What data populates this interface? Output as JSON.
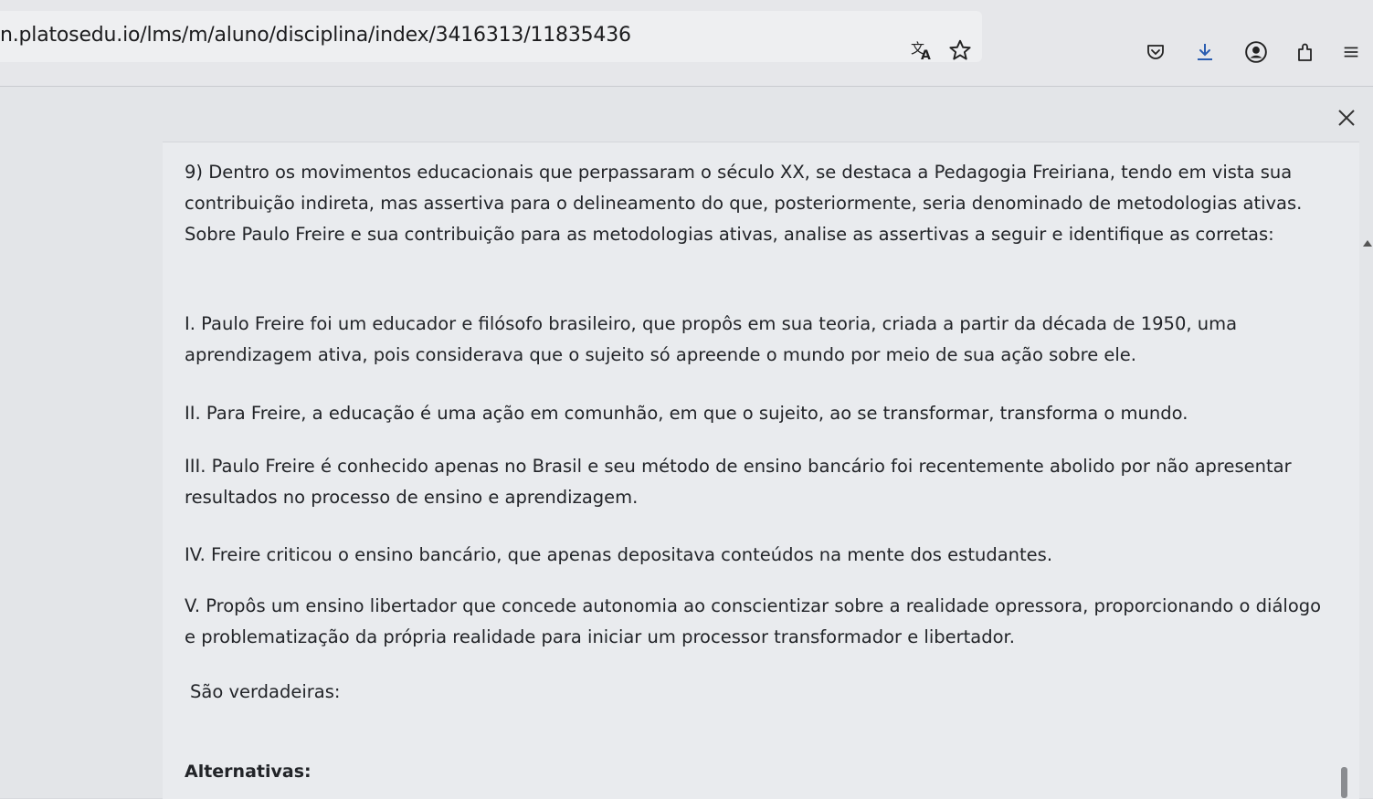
{
  "browser": {
    "url": "n.platosedu.io/lms/m/aluno/disciplina/index/3416313/11835436",
    "icons": [
      "translate-icon",
      "bookmark-star-icon",
      "pocket-icon",
      "download-icon",
      "account-icon",
      "extensions-icon",
      "menu-icon"
    ]
  },
  "question": {
    "prompt": "9) Dentro os movimentos educacionais que perpassaram o século XX, se destaca a Pedagogia Freiriana, tendo em vista sua contribuição indireta, mas assertiva para o delineamento do que, posteriormente, seria denominado de metodologias ativas. Sobre Paulo Freire e sua contribuição para as metodologias ativas, analise as assertivas a seguir e identifique as corretas:",
    "statements": [
      "I. Paulo Freire foi um educador e filósofo brasileiro, que propôs em sua teoria, criada a partir da década de 1950, uma aprendizagem ativa, pois considerava que o sujeito só apreende o mundo por meio de sua ação sobre ele.",
      "II. Para Freire, a educação é uma ação em comunhão, em que o sujeito, ao se transformar, transforma o mundo.",
      "III. Paulo Freire é conhecido apenas no Brasil e seu método de ensino bancário foi recentemente abolido por não apresentar resultados no processo de ensino e aprendizagem.",
      "IV. Freire criticou o ensino bancário, que apenas depositava conteúdos na mente dos estudantes.",
      "V. Propôs um ensino libertador que concede autonomia ao conscientizar sobre a realidade opressora, proporcionando o diálogo e problematização da própria realidade para iniciar um processor transformador e libertador."
    ],
    "true_label": "São verdadeiras:",
    "alternatives_label": "Alternativas:"
  }
}
